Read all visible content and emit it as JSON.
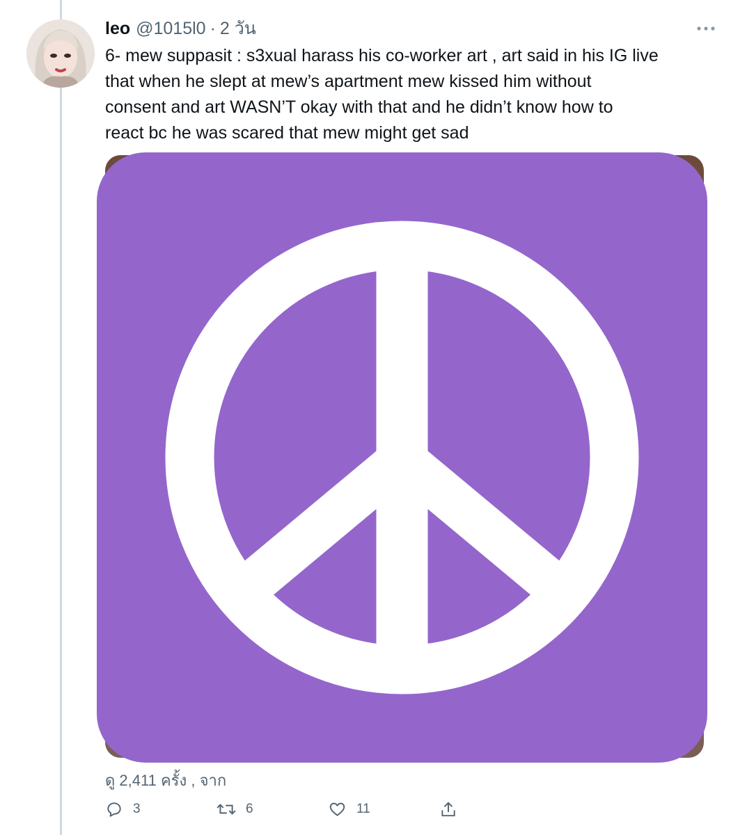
{
  "tweet": {
    "display_name": "leo",
    "handle": "@1015l0",
    "separator": "·",
    "time": "2 วัน",
    "text_lines": [
      "6- mew suppasit : s3xual harass his co-worker art , art said in his IG live",
      "that when he slept at mew’s apartment mew kissed him without",
      "consent and art WASN’T okay with that and he didn’t know how to",
      "react bc he was scared that mew might get sad"
    ],
    "media": {
      "emoji_name": "peace-symbol",
      "emoji_color": "#9466cc",
      "symbol_color": "#ffffff"
    },
    "views": {
      "prefix": "ดู",
      "count": "2,411",
      "suffix": "ครั้ง , จาก"
    },
    "actions": {
      "replies": "3",
      "retweets": "6",
      "likes": "11"
    }
  },
  "icons": {
    "more": "more-horizontal-icon",
    "reply": "reply-icon",
    "retweet": "retweet-icon",
    "like": "heart-icon",
    "share": "share-icon"
  }
}
